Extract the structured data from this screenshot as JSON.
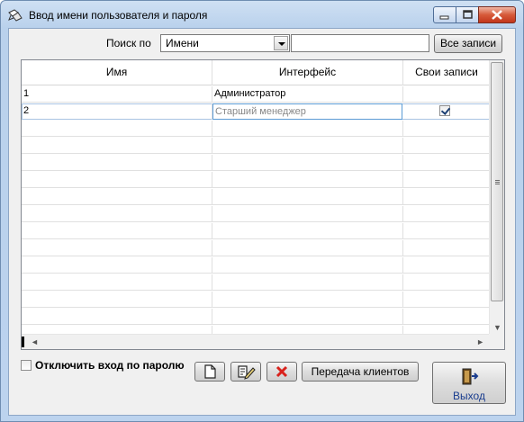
{
  "window": {
    "title": "Ввод имени пользователя и пароля",
    "app_icon": "pencil-pointer-icon",
    "controls": [
      "minimize-icon",
      "maximize-icon",
      "close-icon"
    ]
  },
  "search": {
    "label": "Поиск по",
    "field_value": "Имени",
    "query_value": "",
    "all_records_label": "Все записи"
  },
  "table": {
    "columns": [
      "Имя",
      "Интерфейс",
      "Свои записи"
    ],
    "rows": [
      {
        "name": "1",
        "interface": "Администратор",
        "own_records": false
      },
      {
        "name": "2",
        "interface": "Старший менеджер",
        "own_records": true
      }
    ],
    "selected_row": 2
  },
  "options": {
    "disable_password_label": "Отключить вход по паролю",
    "disable_password_checked": false
  },
  "toolbar": {
    "new_icon": "new-document-icon",
    "edit_icon": "edit-icon",
    "delete_icon": "delete-x-icon",
    "transfer_label": "Передача клиентов",
    "exit_label": "Выход",
    "exit_icon": "exit-door-icon"
  },
  "colors": {
    "accent": "#1a3d8f",
    "delete": "#d9221c",
    "title_bar": "#bcd3ee",
    "close_button": "#d65a3a"
  }
}
